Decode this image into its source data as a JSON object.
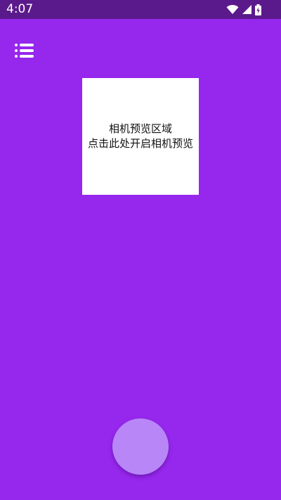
{
  "status_bar": {
    "time": "4:07",
    "icons": [
      "wifi-icon",
      "signal-icon",
      "battery-charging-icon"
    ],
    "background": "#5b1a8c"
  },
  "app": {
    "background": "#9627ed",
    "menu_icon": "list-menu-icon",
    "preview": {
      "line1": "相机预览区域",
      "line2": "点击此处开启相机预览"
    },
    "shutter_color": "#b886f7"
  }
}
